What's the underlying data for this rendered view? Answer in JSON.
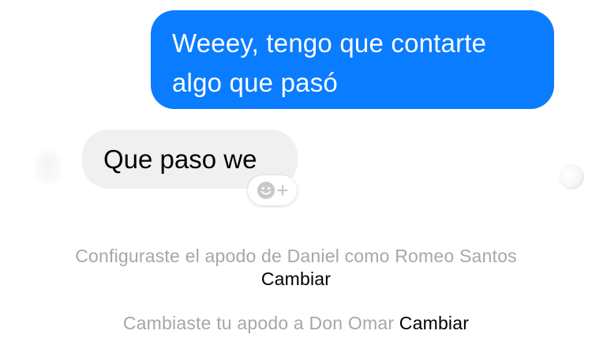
{
  "conversation": {
    "messages": [
      {
        "direction": "outgoing",
        "lines": [
          "Weeey, tengo que contarte",
          "algo que pasó"
        ],
        "bubble_color": "#0a7cff"
      },
      {
        "direction": "incoming",
        "text": "Que paso we",
        "bubble_color": "#f0f0f0"
      }
    ],
    "reaction_button": {
      "icons": [
        "smiley-icon",
        "plus-icon"
      ]
    }
  },
  "system_messages": [
    {
      "text": "Configuraste el apodo de Daniel como Romeo Santos",
      "action_label": "Cambiar"
    },
    {
      "text": "Cambiaste tu apodo a Don Omar",
      "action_label": "Cambiar"
    }
  ],
  "colors": {
    "outgoing_bubble": "#0a7cff",
    "incoming_bubble": "#f0f0f0",
    "system_text": "#a7a7a7",
    "action_text": "#000000"
  }
}
